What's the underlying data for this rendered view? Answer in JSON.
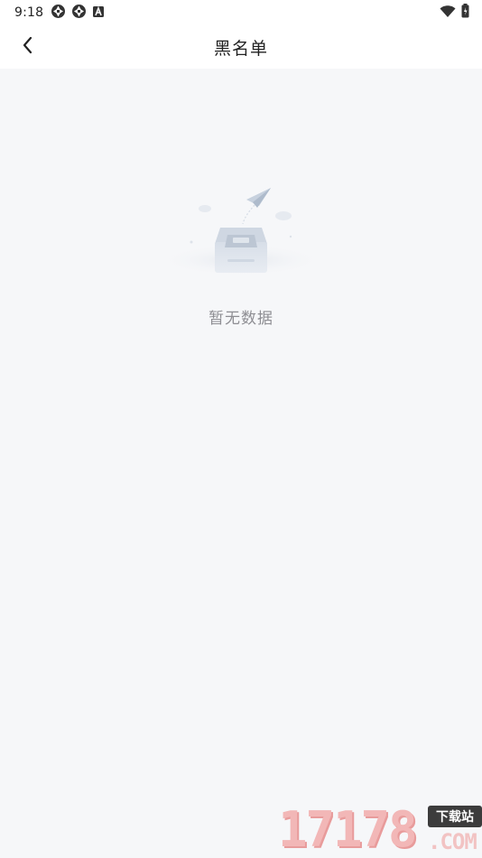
{
  "status_bar": {
    "time": "9:18",
    "left_icons": [
      "aperture-icon",
      "aperture-icon",
      "a-notification-icon"
    ],
    "right_icons": [
      "wifi-icon",
      "battery-icon"
    ]
  },
  "header": {
    "title": "黑名单",
    "back_icon": "chevron-left-icon"
  },
  "empty_state": {
    "message": "暂无数据",
    "illustration": "empty-inbox-paper-plane"
  },
  "watermark": {
    "digits": "17178",
    "badge": "下载站",
    "suffix": ".COM"
  },
  "colors": {
    "background": "#f6f7f9",
    "header_bg": "#ffffff",
    "title_text": "#222222",
    "empty_text": "#8e8e93"
  }
}
